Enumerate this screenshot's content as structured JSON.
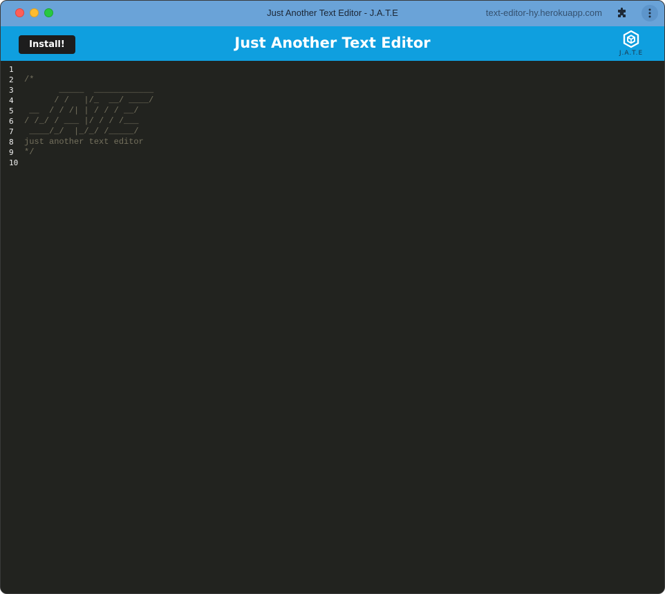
{
  "browser": {
    "window_title": "Just Another Text Editor - J.A.T.E",
    "url": "text-editor-hy.herokuapp.com",
    "extensions_icon": "puzzle-icon",
    "menu_icon": "kebab-menu-icon"
  },
  "header": {
    "install_label": "Install!",
    "title": "Just Another Text Editor",
    "logo_text": "J.A.T.E",
    "background_color": "#0f9fdf"
  },
  "editor": {
    "lines": [
      {
        "number": "1",
        "text": ""
      },
      {
        "number": "2",
        "text": "/*"
      },
      {
        "number": "3",
        "text": "       _____  ____________"
      },
      {
        "number": "4",
        "text": "      / /   |/_  __/ ____/"
      },
      {
        "number": "5",
        "text": " __  / / /| | / / / __/"
      },
      {
        "number": "6",
        "text": "/ /_/ / ___ |/ / / /___"
      },
      {
        "number": "7",
        "text": " ____/_/  |_/_/ /_____/"
      },
      {
        "number": "8",
        "text": "just another text editor"
      },
      {
        "number": "9",
        "text": "*/"
      },
      {
        "number": "10",
        "text": ""
      }
    ],
    "background_color": "#22231f",
    "comment_color": "#75715e"
  }
}
